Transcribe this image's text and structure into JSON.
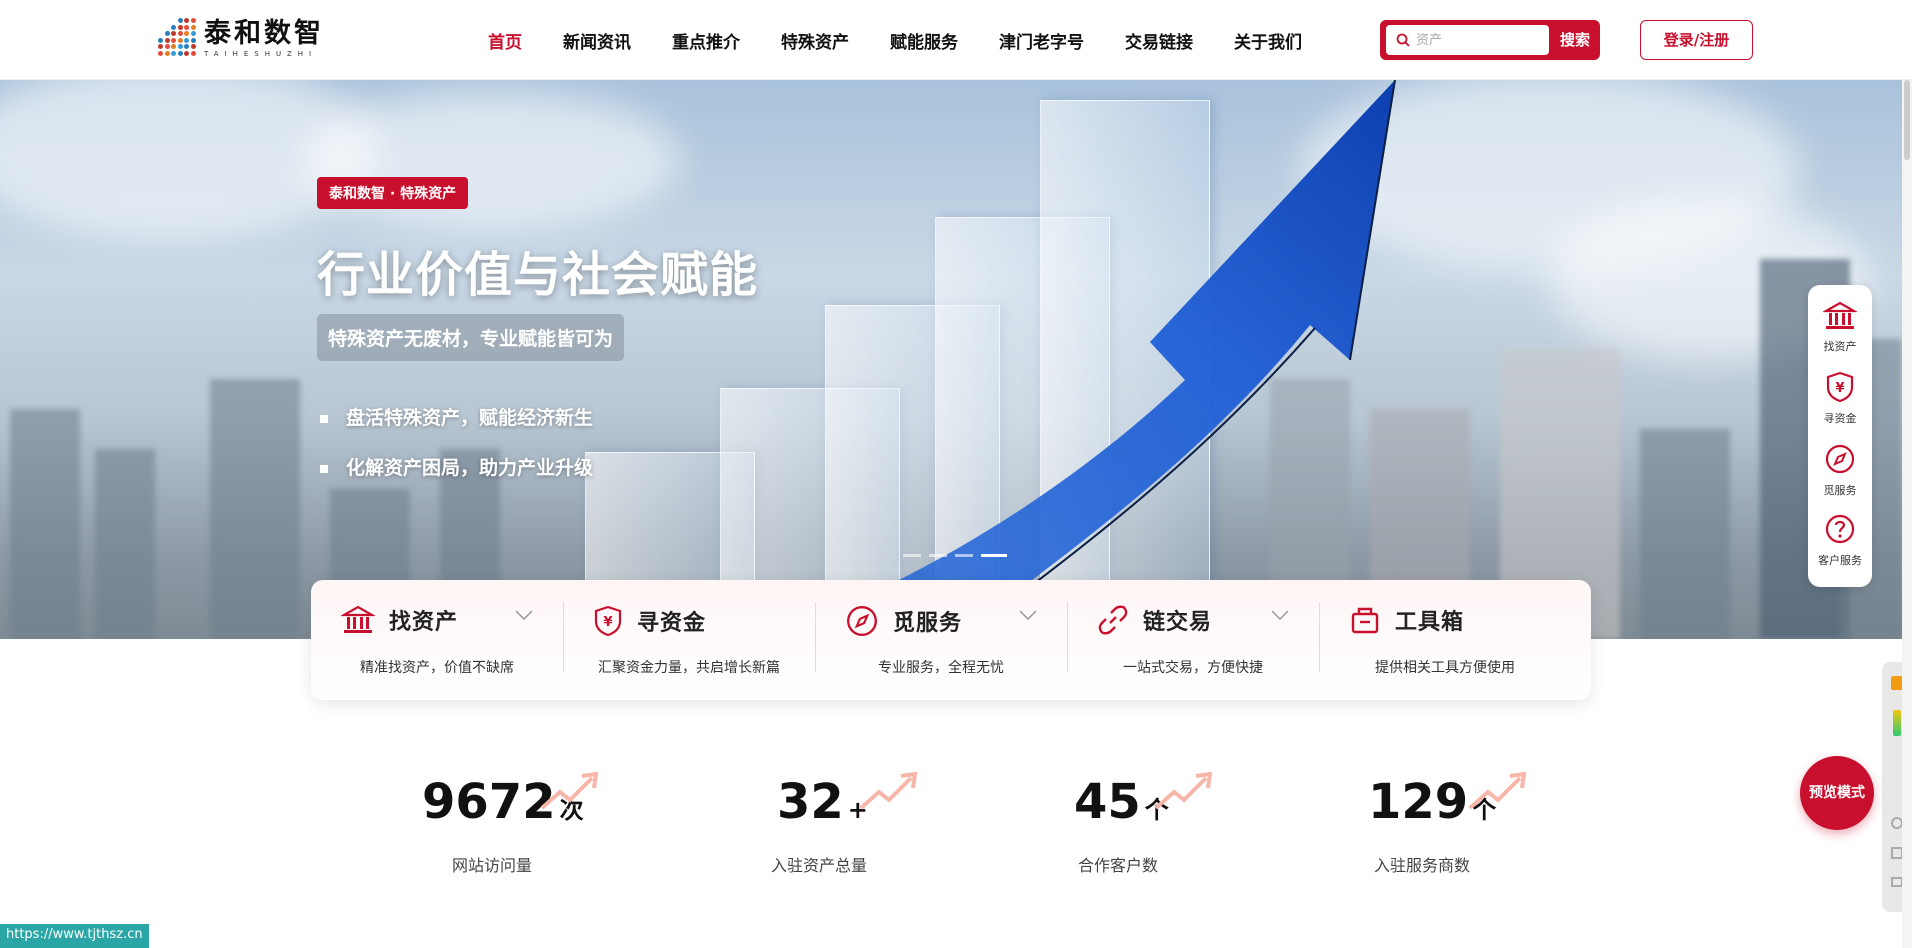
{
  "brand": {
    "name_cn": "泰和数智",
    "name_en": "TAIHESHUZHI"
  },
  "nav": {
    "items": [
      {
        "label": "首页",
        "active": true
      },
      {
        "label": "新闻资讯"
      },
      {
        "label": "重点推介"
      },
      {
        "label": "特殊资产"
      },
      {
        "label": "赋能服务"
      },
      {
        "label": "津门老字号"
      },
      {
        "label": "交易链接"
      },
      {
        "label": "关于我们"
      }
    ]
  },
  "search": {
    "placeholder": "资产",
    "button": "搜索"
  },
  "login": {
    "label": "登录/注册"
  },
  "hero": {
    "badge": "泰和数智 · 特殊资产",
    "title": "行业价值与社会赋能",
    "subtitle": "特殊资产无废材，专业赋能皆可为",
    "bullets": [
      "盘活特殊资产，赋能经济新生",
      "化解资产困局，助力产业升级"
    ],
    "slides": 4,
    "active_slide": 4
  },
  "sidebar": {
    "items": [
      {
        "label": "找资产",
        "icon": "bank-icon"
      },
      {
        "label": "寻资金",
        "icon": "yuan-shield-icon"
      },
      {
        "label": "觅服务",
        "icon": "compass-icon"
      },
      {
        "label": "客户服务",
        "icon": "question-icon"
      }
    ]
  },
  "features": [
    {
      "title": "找资产",
      "desc": "精准找资产，价值不缺席",
      "icon": "bank-icon",
      "dropdown": true
    },
    {
      "title": "寻资金",
      "desc": "汇聚资金力量，共启增长新篇",
      "icon": "yuan-shield-icon",
      "dropdown": false
    },
    {
      "title": "觅服务",
      "desc": "专业服务，全程无忧",
      "icon": "compass-icon",
      "dropdown": true
    },
    {
      "title": "链交易",
      "desc": "一站式交易，方便快捷",
      "icon": "link-icon",
      "dropdown": true
    },
    {
      "title": "工具箱",
      "desc": "提供相关工具方便使用",
      "icon": "toolbox-icon",
      "dropdown": false
    }
  ],
  "stats": [
    {
      "value": "9672",
      "unit": "次",
      "label": "网站访问量"
    },
    {
      "value": "32",
      "unit": "+",
      "label": "入驻资产总量"
    },
    {
      "value": "45",
      "unit": "个",
      "label": "合作客户数"
    },
    {
      "value": "129",
      "unit": "个",
      "label": "入驻服务商数"
    }
  ],
  "preview_mode": "预览模式",
  "status_url": "https://www.tjthsz.cn",
  "colors": {
    "primary": "#c8102e",
    "hero_blue": "#1f5fd6"
  }
}
